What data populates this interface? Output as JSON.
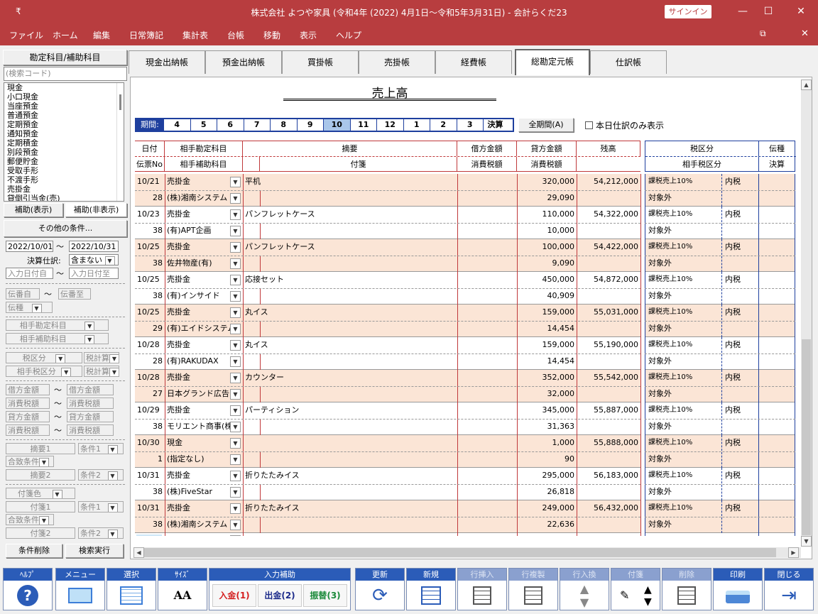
{
  "window": {
    "title": "株式会社 よつや家具 (令和4年 (2022) 4月1日～令和5年3月31日) - 会計らくだ23",
    "signin": "サインイン",
    "sysmenu": "₹",
    "min": "—",
    "max": "☐",
    "close": "✕",
    "restore": "⧉",
    "close2": "✕"
  },
  "menu": [
    "ファイル",
    "ホーム",
    "編集",
    "日常簿記",
    "集計表",
    "台帳",
    "移動",
    "表示",
    "ヘルプ"
  ],
  "left": {
    "header": "勘定科目/補助科目",
    "search_placeholder": "(検索コード)",
    "accounts": [
      "現金",
      "小口現金",
      "当座預金",
      "普通預金",
      "定期預金",
      "通知預金",
      "定期積金",
      "別段預金",
      "郵便貯金",
      "受取手形",
      "不渡手形",
      "売掛金",
      "貸倒引当金(売)"
    ],
    "sub_show": "補助(表示)",
    "sub_hide": "補助(非表示)",
    "other_cond": "その他の条件...",
    "date_from": "2022/10/01",
    "date_to": "2022/10/31",
    "tilde": "〜",
    "settle_label": "決算仕訳:",
    "settle_value": "含まない",
    "input_from": "入力日付自",
    "input_to": "入力日付至",
    "slip_from": "伝番自",
    "slip_to": "伝番至",
    "slip_type": "伝種",
    "counter_acct": "相手勘定科目",
    "counter_sub": "相手補助科目",
    "tax_cls": "税区分",
    "tax_calc1": "税計算",
    "counter_tax": "相手税区分",
    "tax_calc2": "税計算",
    "debit_from": "借方金額",
    "debit_to": "借方金額",
    "dtax_from": "消費税額",
    "dtax_to": "消費税額",
    "credit_from": "貸方金額",
    "credit_to": "貸方金額",
    "ctax_from": "消費税額",
    "ctax_to": "消費税額",
    "memo1": "摘要1",
    "cond1": "条件1",
    "combine1": "合致条件",
    "memo2": "摘要2",
    "cond2": "条件2",
    "tagcolor": "付箋色",
    "tag1": "付箋1",
    "tcond1": "条件1",
    "combine2": "合致条件",
    "tag2": "付箋2",
    "tcond2": "条件2",
    "clear": "条件削除",
    "search": "検索実行"
  },
  "tabs": [
    "現金出納帳",
    "預金出納帳",
    "買掛帳",
    "売掛帳",
    "経費帳",
    "総勘定元帳",
    "仕訳帳"
  ],
  "page_title": "売上高",
  "periods": {
    "label": "期間:",
    "items": [
      "4",
      "5",
      "6",
      "7",
      "8",
      "9",
      "10",
      "11",
      "12",
      "1",
      "2",
      "3",
      "決算"
    ],
    "selected": "10",
    "all": "全期間(A)",
    "today_only": "本日仕訳のみ表示"
  },
  "headers": {
    "date": "日付",
    "slip": "伝票No",
    "counter": "相手勘定科目",
    "counter_sub": "相手補助科目",
    "memo": "摘要",
    "tag": "付箋",
    "debit": "借方金額",
    "debit_tax": "消費税額",
    "credit": "貸方金額",
    "credit_tax": "消費税額",
    "balance": "残高",
    "taxcls": "税区分",
    "counter_tax": "相手税区分",
    "slip_type": "伝種",
    "settle": "決算"
  },
  "rows": [
    {
      "date": "10/21",
      "no": "28",
      "acct": "売掛金",
      "sub": "(株)湘南システム",
      "memo": "平机",
      "credit": "320,000",
      "tax": "29,090",
      "balance": "54,212,000",
      "taxcls": "課税売上10%",
      "taxin": "内税",
      "ctax": "対象外"
    },
    {
      "date": "10/23",
      "no": "38",
      "acct": "売掛金",
      "sub": "(有)APT企画",
      "memo": "パンフレットケース",
      "credit": "110,000",
      "tax": "10,000",
      "balance": "54,322,000",
      "taxcls": "課税売上10%",
      "taxin": "内税",
      "ctax": "対象外"
    },
    {
      "date": "10/25",
      "no": "38",
      "acct": "売掛金",
      "sub": "佐井物産(有)",
      "memo": "パンフレットケース",
      "credit": "100,000",
      "tax": "9,090",
      "balance": "54,422,000",
      "taxcls": "課税売上10%",
      "taxin": "内税",
      "ctax": "対象外"
    },
    {
      "date": "10/25",
      "no": "38",
      "acct": "売掛金",
      "sub": "(有)インサイド",
      "memo": "応接セット",
      "credit": "450,000",
      "tax": "40,909",
      "balance": "54,872,000",
      "taxcls": "課税売上10%",
      "taxin": "内税",
      "ctax": "対象外"
    },
    {
      "date": "10/25",
      "no": "29",
      "acct": "売掛金",
      "sub": "(有)エイドシステム",
      "memo": "丸イス",
      "credit": "159,000",
      "tax": "14,454",
      "balance": "55,031,000",
      "taxcls": "課税売上10%",
      "taxin": "内税",
      "ctax": "対象外"
    },
    {
      "date": "10/28",
      "no": "28",
      "acct": "売掛金",
      "sub": "(有)RAKUDAX",
      "memo": "丸イス",
      "credit": "159,000",
      "tax": "14,454",
      "balance": "55,190,000",
      "taxcls": "課税売上10%",
      "taxin": "内税",
      "ctax": "対象外"
    },
    {
      "date": "10/28",
      "no": "27",
      "acct": "売掛金",
      "sub": "日本グランド広告",
      "memo": "カウンター",
      "credit": "352,000",
      "tax": "32,000",
      "balance": "55,542,000",
      "taxcls": "課税売上10%",
      "taxin": "内税",
      "ctax": "対象外"
    },
    {
      "date": "10/29",
      "no": "38",
      "acct": "売掛金",
      "sub": "モリエント商事(株",
      "memo": "パーティション",
      "credit": "345,000",
      "tax": "31,363",
      "balance": "55,887,000",
      "taxcls": "課税売上10%",
      "taxin": "内税",
      "ctax": "対象外"
    },
    {
      "date": "10/30",
      "no": "1",
      "acct": "現金",
      "sub": "(指定なし)",
      "memo": "",
      "credit": "1,000",
      "tax": "90",
      "balance": "55,888,000",
      "taxcls": "課税売上10%",
      "taxin": "内税",
      "ctax": "対象外"
    },
    {
      "date": "10/31",
      "no": "38",
      "acct": "売掛金",
      "sub": "(株)FiveStar",
      "memo": "折りたたみイス",
      "credit": "295,000",
      "tax": "26,818",
      "balance": "56,183,000",
      "taxcls": "課税売上10%",
      "taxin": "内税",
      "ctax": "対象外"
    },
    {
      "date": "10/31",
      "no": "38",
      "acct": "売掛金",
      "sub": "(株)湘南システム",
      "memo": "折りたたみイス",
      "credit": "249,000",
      "tax": "22,636",
      "balance": "56,432,000",
      "taxcls": "課税売上10%",
      "taxin": "内税",
      "ctax": "対象外"
    }
  ],
  "toolbar": {
    "help": "ﾍﾙﾌﾟ",
    "menu": "メニュー",
    "select": "選択",
    "size": "ｻｲｽﾞ",
    "input_assist": "入力補助",
    "deposit": "入金(1)",
    "withdraw": "出金(2)",
    "transfer": "振替(3)",
    "refresh": "更新",
    "new": "新規",
    "row_insert": "行挿入",
    "row_copy": "行複製",
    "row_swap": "行入換",
    "tag": "付箋",
    "delete": "削除",
    "print": "印刷",
    "close": "閉じる",
    "size_icon": "AA"
  },
  "colors": {
    "titlebar": "#b83d3f",
    "accent": "#2b5cb8",
    "row_alt": "#fbe5d6",
    "grid_red": "#c0393b"
  }
}
